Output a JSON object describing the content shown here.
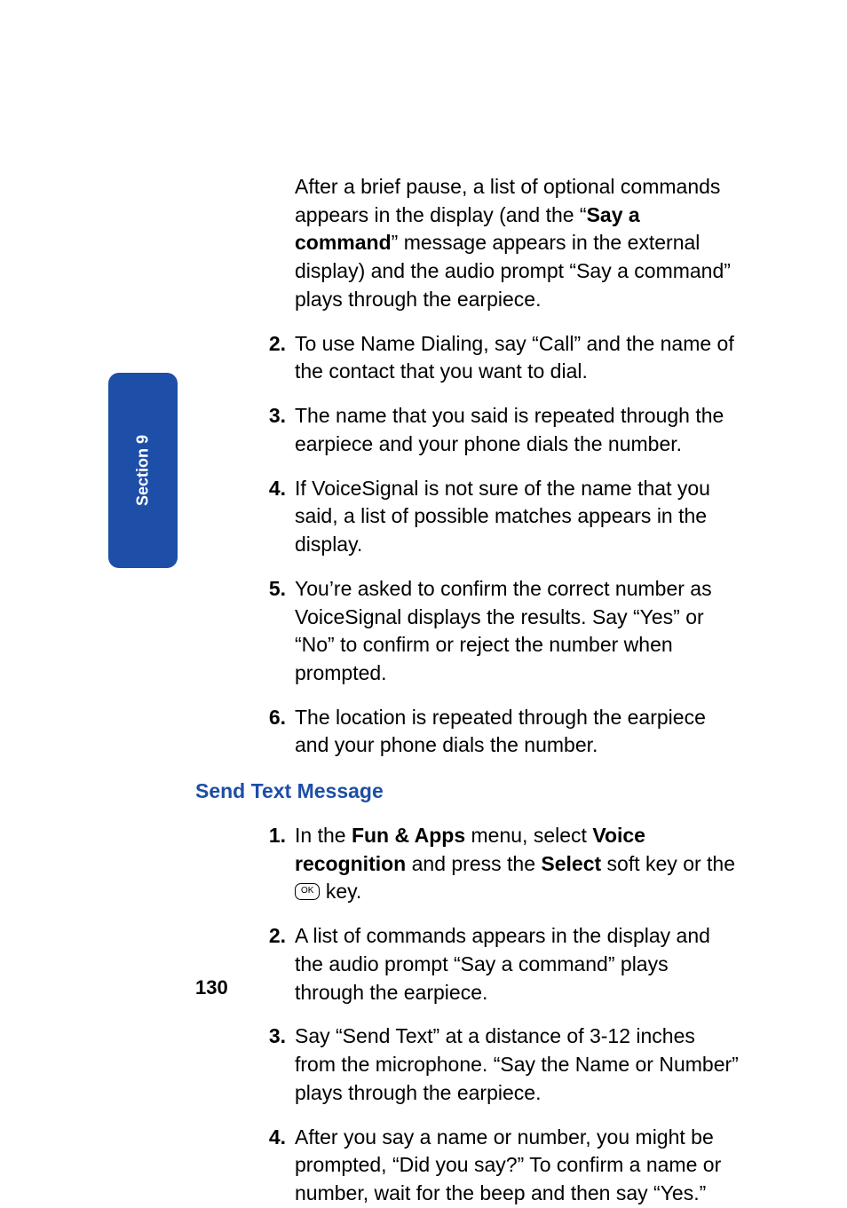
{
  "sideTab": "Section 9",
  "intro": {
    "pre": "After a brief pause, a list of optional commands appears in the display (and the “",
    "bold": "Say a command",
    "post": "” message appears in the external display) and the audio prompt “Say a command” plays through the earpiece."
  },
  "list1": {
    "items": [
      {
        "num": "2.",
        "text": "To use Name Dialing, say “Call” and the name of the contact that you want to dial."
      },
      {
        "num": "3.",
        "text": "The name that you said is repeated through the earpiece and your phone dials the number."
      },
      {
        "num": "4.",
        "text": "If VoiceSignal is not sure of the name that you said, a list of possible matches appears in the display."
      },
      {
        "num": "5.",
        "text": "You’re asked to confirm the correct number as VoiceSignal displays the results. Say “Yes” or “No” to confirm or reject the number when prompted."
      },
      {
        "num": "6.",
        "text": "The location is repeated through the earpiece and your phone dials the number."
      }
    ]
  },
  "heading": "Send Text Message",
  "list2": {
    "item1": {
      "num": "1.",
      "p1": "In the ",
      "b1": "Fun & Apps",
      "p2": " menu, select ",
      "b2": "Voice recognition",
      "p3": " and press the ",
      "b3": "Select",
      "p4": " soft key or the ",
      "ok": "OK",
      "p5": " key."
    },
    "items": [
      {
        "num": "2.",
        "text": "A list of commands appears in the display and the audio prompt “Say a command” plays through the earpiece."
      },
      {
        "num": "3.",
        "text": "Say “Send Text” at a distance of 3-12 inches from the microphone. “Say the Name or Number” plays through the earpiece."
      },
      {
        "num": "4.",
        "text": "After you say a name or number, you might be prompted, “Did you say?” To confirm a name or number, wait for the beep and then say “Yes.”"
      }
    ]
  },
  "pageNumber": "130"
}
